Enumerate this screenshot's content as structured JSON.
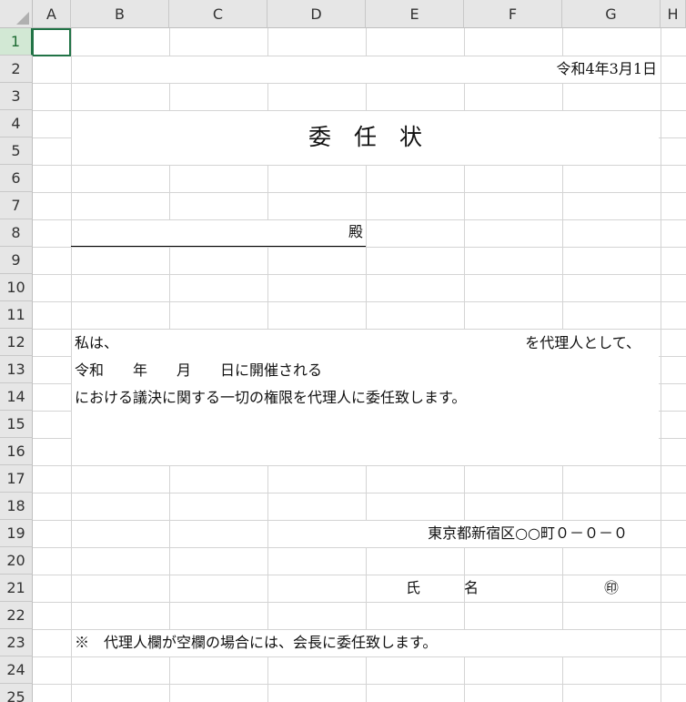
{
  "columns": [
    "A",
    "B",
    "C",
    "D",
    "E",
    "F",
    "G",
    "H"
  ],
  "rows": [
    "1",
    "2",
    "3",
    "4",
    "5",
    "6",
    "7",
    "8",
    "9",
    "10",
    "11",
    "12",
    "13",
    "14",
    "15",
    "16",
    "17",
    "18",
    "19",
    "20",
    "21",
    "22",
    "23",
    "24",
    "25"
  ],
  "selected_row": "1",
  "document": {
    "date": "令和4年3月1日",
    "title": "委　任　状",
    "addressee_suffix": "殿",
    "line1_start": "私は、",
    "line1_end": "を代理人として、",
    "line2": "令和　　年　　月　　日に開催される",
    "line3": "における議決に関する一切の権限を代理人に委任致します。",
    "address": "東京都新宿区○○町０－０－０",
    "name_label": "氏　　　名",
    "seal": "㊞",
    "note": "※　代理人欄が空欄の場合には、会長に委任致します。"
  }
}
